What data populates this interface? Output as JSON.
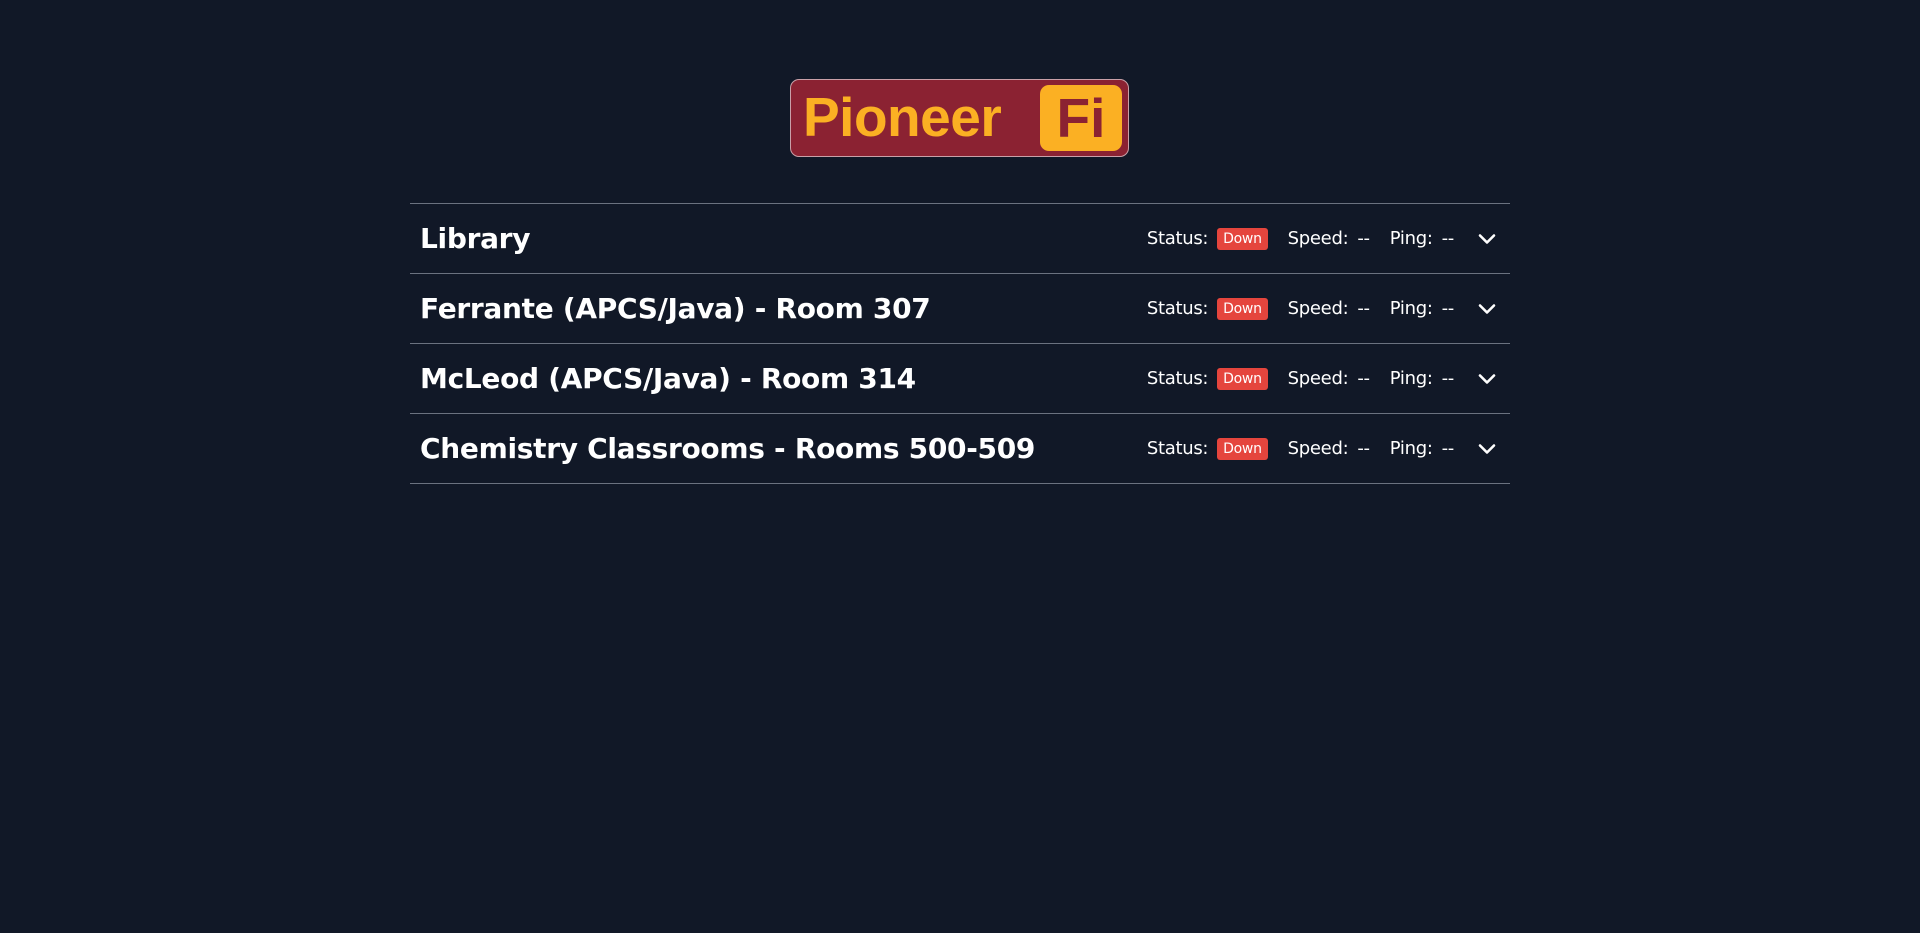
{
  "logo": {
    "word": "Pioneer",
    "badge": "Fi"
  },
  "labels": {
    "status": "Status:",
    "speed": "Speed:",
    "ping": "Ping:"
  },
  "rooms": [
    {
      "name": "Library",
      "status": "Down",
      "speed": "--",
      "ping": "--"
    },
    {
      "name": "Ferrante (APCS/Java) - Room 307",
      "status": "Down",
      "speed": "--",
      "ping": "--"
    },
    {
      "name": "McLeod (APCS/Java) - Room 314",
      "status": "Down",
      "speed": "--",
      "ping": "--"
    },
    {
      "name": "Chemistry Classrooms - Rooms 500-509",
      "status": "Down",
      "speed": "--",
      "ping": "--"
    }
  ],
  "colors": {
    "background": "#111827",
    "logo_bg": "#8b2232",
    "logo_accent": "#fbb023",
    "status_down": "#e5453d",
    "divider": "#6b7280"
  },
  "icons": {
    "expand": "chevron-down-icon"
  }
}
